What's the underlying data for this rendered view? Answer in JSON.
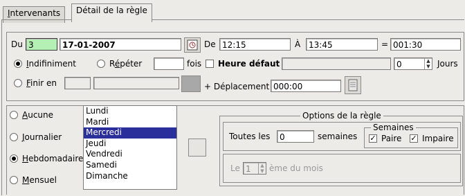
{
  "tabs": {
    "intervenants": "Intervenants",
    "detail": "Détail de la règle"
  },
  "top": {
    "du_label": "Du",
    "du_num": "3",
    "du_date": "17-01-2007",
    "de_label": "De",
    "de_value": "12:15",
    "a_label": "À",
    "a_value": "13:45",
    "eq_label": "=",
    "duree_value": "001:30",
    "indef_label": "Indifiniment",
    "repeter_label": "Répéter",
    "repeter_value": "",
    "fois_label": "fois",
    "heure_defaut_label": "Heure défaut",
    "heure_defaut_value": "",
    "jours_value": "0",
    "jours_label": "Jours",
    "finir_label": "Finir en",
    "deplacement_label": "+ Déplacement",
    "deplacement_value": "000:00"
  },
  "freq": {
    "aucune": "Aucune",
    "journalier": "Journalier",
    "hebdo": "Hebdomadaire",
    "mensuel": "Mensuel"
  },
  "days": [
    "Lundi",
    "Mardi",
    "Mercredi",
    "Jeudi",
    "Vendredi",
    "Samedi",
    "Dimanche"
  ],
  "selected_day": "Mercredi",
  "options": {
    "title": "Options de la règle",
    "toutes_label": "Toutes les",
    "toutes_value": "0",
    "semaines_label": "semaines",
    "semaines_group": "Semaines",
    "paire_label": "Paire",
    "impaire_label": "Impaire",
    "le_label": "Le",
    "le_value": "1",
    "eme_label": "ème du mois"
  }
}
